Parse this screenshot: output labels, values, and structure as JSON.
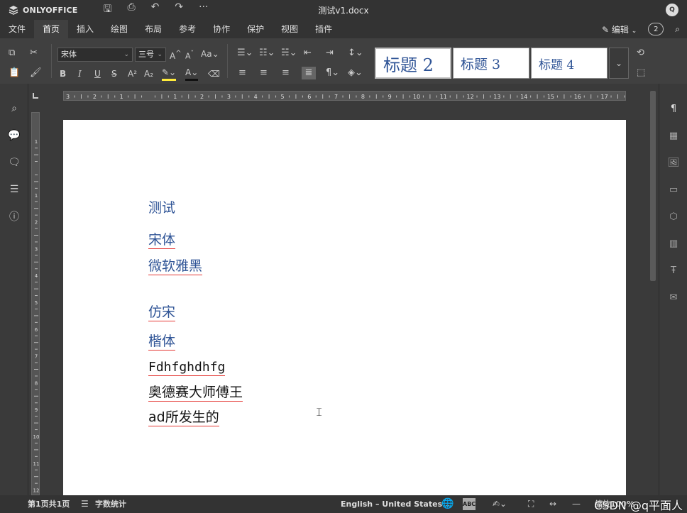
{
  "titlebar": {
    "brand": "ONLYOFFICE",
    "doc_title": "测试v1.docx",
    "avatar": "Q",
    "more": "···"
  },
  "menu": {
    "items": [
      "文件",
      "首页",
      "插入",
      "绘图",
      "布局",
      "参考",
      "协作",
      "保护",
      "视图",
      "插件"
    ],
    "active_index": 1,
    "edit_label": "编辑",
    "users_count": "2"
  },
  "toolbar": {
    "font_name": "宋体",
    "font_size": "三号",
    "styles": [
      "标题 2",
      "标题 3",
      "标题 4"
    ]
  },
  "document": {
    "lines": [
      {
        "text": "测试",
        "color": "#2f5496",
        "underline": false
      },
      {
        "text": "宋体",
        "color": "#2f5496",
        "underline": true
      },
      {
        "text": "微软雅黑",
        "color": "#2f5496",
        "underline": true
      },
      {
        "text": "仿宋",
        "color": "#2f5496",
        "underline": true
      },
      {
        "text": "楷体",
        "color": "#2f5496",
        "underline": true
      },
      {
        "text": "Fdhfghdhfg",
        "color": "#111111",
        "underline": true
      },
      {
        "text": "奥德赛大师傅王",
        "color": "#111111",
        "underline": true
      },
      {
        "text": "ad所发生的",
        "color": "#111111",
        "underline": true
      }
    ]
  },
  "statusbar": {
    "page_info": "第1页共1页",
    "word_count": "字数统计",
    "language": "English – United States",
    "zoom": "缩放100%",
    "spell": "ABC"
  },
  "watermark": "CSDN @q平面人",
  "ruler": {
    "h_labels": [
      "3",
      "2",
      "1",
      "1",
      "2",
      "3",
      "4",
      "5",
      "6",
      "7",
      "8",
      "9",
      "10",
      "11",
      "12",
      "13",
      "14",
      "15",
      "16",
      "17"
    ],
    "v_labels": [
      "2",
      "1",
      "1",
      "2",
      "3",
      "4",
      "5",
      "6",
      "7",
      "8",
      "9",
      "10",
      "11"
    ]
  },
  "colors": {
    "accent_blue": "#2f5496",
    "spell_red": "#e53935"
  }
}
